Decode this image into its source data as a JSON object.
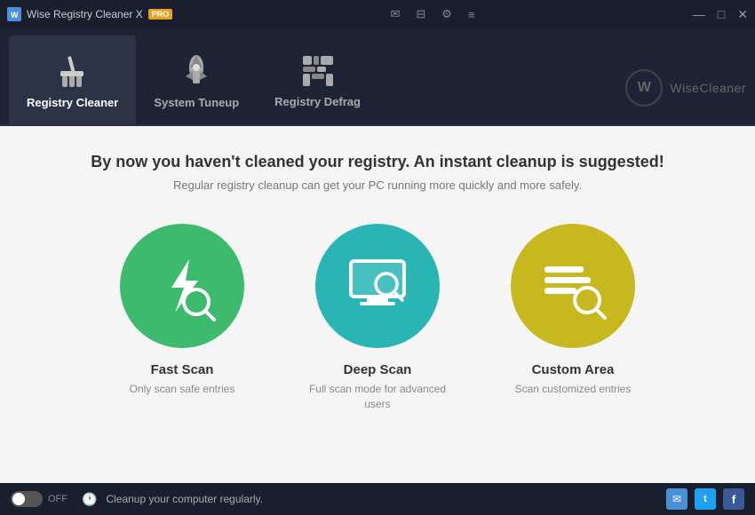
{
  "titlebar": {
    "app_name": "Wise Registry Cleaner X",
    "pro_badge": "PRO",
    "controls": {
      "minimize": "—",
      "maximize": "□",
      "close": "✕"
    }
  },
  "toolbar_icons": {
    "email": "✉",
    "message": "▤",
    "settings": "⚙",
    "menu": "≡"
  },
  "navbar": {
    "tabs": [
      {
        "id": "registry-cleaner",
        "label": "Registry Cleaner",
        "active": true
      },
      {
        "id": "system-tuneup",
        "label": "System Tuneup",
        "active": false
      },
      {
        "id": "registry-defrag",
        "label": "Registry Defrag",
        "active": false
      }
    ],
    "logo": {
      "letter": "W",
      "name": "WiseCleaner"
    }
  },
  "main": {
    "headline": "By now you haven't cleaned your registry. An instant cleanup is suggested!",
    "subline": "Regular registry cleanup can get your PC running more quickly and more safely.",
    "scan_cards": [
      {
        "id": "fast-scan",
        "title": "Fast Scan",
        "desc": "Only scan safe entries",
        "color": "green"
      },
      {
        "id": "deep-scan",
        "title": "Deep Scan",
        "desc": "Full scan mode for advanced users",
        "color": "teal"
      },
      {
        "id": "custom-area",
        "title": "Custom Area",
        "desc": "Scan customized entries",
        "color": "yellow"
      }
    ]
  },
  "footer": {
    "toggle_label": "OFF",
    "message": "Cleanup your computer regularly.",
    "icons": {
      "email": "✉",
      "twitter": "t",
      "facebook": "f"
    }
  }
}
